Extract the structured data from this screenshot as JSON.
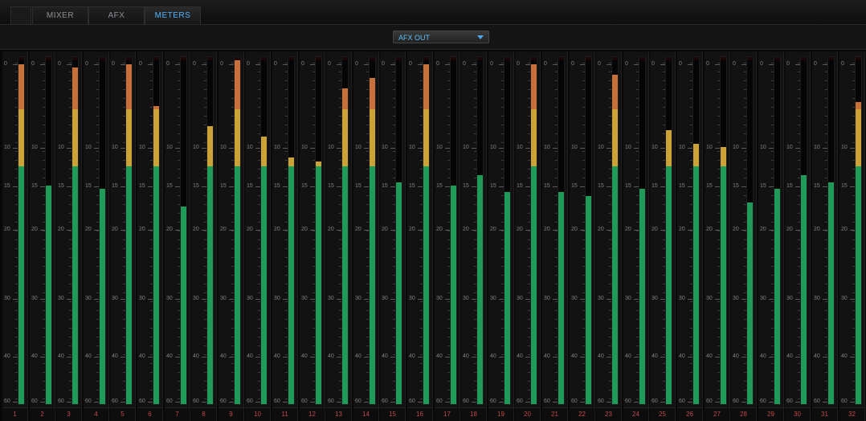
{
  "tabs": [
    {
      "label": "MIXER",
      "active": false
    },
    {
      "label": "AFX",
      "active": false
    },
    {
      "label": "METERS",
      "active": true
    }
  ],
  "output_select": {
    "value": "AFX OUT"
  },
  "scale_labels": [
    "0",
    "10",
    "15",
    "20",
    "30",
    "40",
    "60"
  ],
  "channels": [
    {
      "label": "1",
      "level": 0.98
    },
    {
      "label": "2",
      "level": 0.63
    },
    {
      "label": "3",
      "level": 0.97
    },
    {
      "label": "4",
      "level": 0.62
    },
    {
      "label": "5",
      "level": 0.98
    },
    {
      "label": "6",
      "level": 0.86
    },
    {
      "label": "7",
      "level": 0.57
    },
    {
      "label": "8",
      "level": 0.8
    },
    {
      "label": "9",
      "level": 0.99
    },
    {
      "label": "10",
      "level": 0.77
    },
    {
      "label": "11",
      "level": 0.71
    },
    {
      "label": "12",
      "level": 0.7
    },
    {
      "label": "13",
      "level": 0.91
    },
    {
      "label": "14",
      "level": 0.94
    },
    {
      "label": "15",
      "level": 0.64
    },
    {
      "label": "16",
      "level": 0.98
    },
    {
      "label": "17",
      "level": 0.63
    },
    {
      "label": "18",
      "level": 0.66
    },
    {
      "label": "19",
      "level": 0.61
    },
    {
      "label": "20",
      "level": 0.98
    },
    {
      "label": "21",
      "level": 0.61
    },
    {
      "label": "22",
      "level": 0.6
    },
    {
      "label": "23",
      "level": 0.95
    },
    {
      "label": "24",
      "level": 0.62
    },
    {
      "label": "25",
      "level": 0.79
    },
    {
      "label": "26",
      "level": 0.75
    },
    {
      "label": "27",
      "level": 0.74
    },
    {
      "label": "28",
      "level": 0.58
    },
    {
      "label": "29",
      "level": 0.62
    },
    {
      "label": "30",
      "level": 0.66
    },
    {
      "label": "31",
      "level": 0.64
    },
    {
      "label": "32",
      "level": 0.87
    }
  ],
  "colors": {
    "green": "#1f9a59",
    "yellow": "#caa238",
    "orange": "#c8703a",
    "active_tab": "#4fb3ff"
  }
}
